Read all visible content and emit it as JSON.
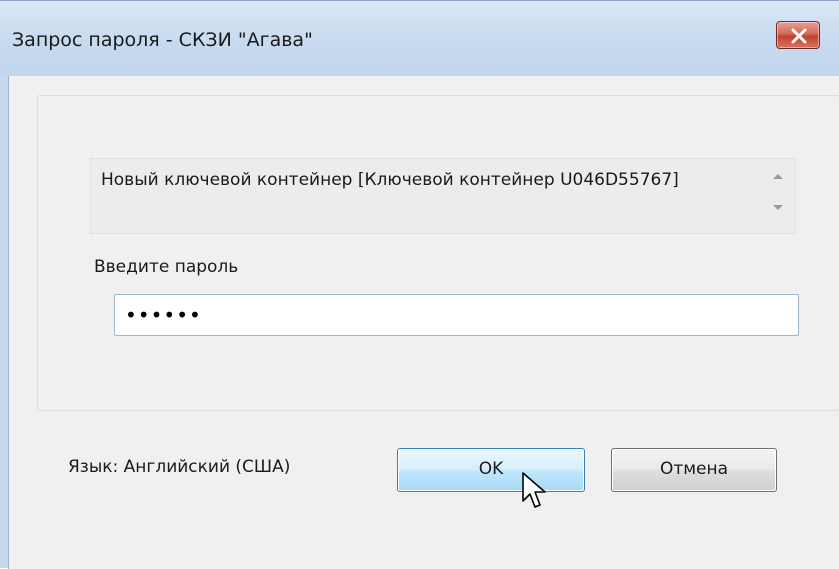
{
  "window": {
    "title": "Запрос пароля - СКЗИ \"Агава\"",
    "close_icon": "close-icon",
    "close_color": "#c3412f"
  },
  "container": {
    "text": "Новый ключевой контейнер [Ключевой контейнер U046D55767]",
    "scroll_up_icon": "scroll-up-arrow-icon",
    "scroll_down_icon": "scroll-down-arrow-icon"
  },
  "password": {
    "label": "Введите пароль",
    "value": "••••••"
  },
  "footer": {
    "language_label": "Язык: Английский (США)",
    "ok_label": "OK",
    "cancel_label": "Отмена"
  },
  "colors": {
    "title_bar": "#c6d9ef",
    "client_bg": "#f0f0f0",
    "ok_accent": "#3c7fb1"
  }
}
